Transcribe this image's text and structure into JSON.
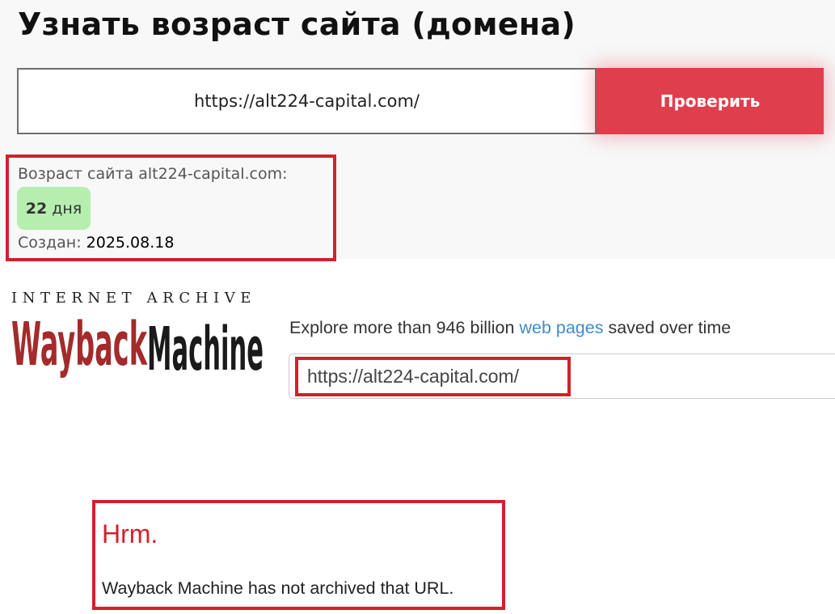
{
  "age_checker": {
    "title": "Узнать возраст сайта (домена)",
    "input_value": "https://alt224-capital.com/",
    "button_label": "Проверить",
    "result_label": "Возраст сайта alt224-capital.com:",
    "age_number": "22",
    "age_unit": "дня",
    "created_label": "Создан:",
    "created_value": "2025.08.18",
    "accent_color": "#df3e4c",
    "badge_color": "#b6eeb0",
    "highlight_color": "#d51f2c"
  },
  "wayback": {
    "header_text": "INTERNET ARCHIVE",
    "logo_text_1": "Wayback",
    "logo_text_2": "Machine",
    "tagline_prefix": "Explore more than 946 billion",
    "tagline_link": "web pages",
    "tagline_suffix": "saved over time",
    "search_value": "https://alt224-capital.com/",
    "error_title": "Hrm.",
    "error_message": "Wayback Machine has not archived that URL.",
    "logo_red": "#a32b2b",
    "logo_black": "#1a1a1a",
    "link_color": "#428bca"
  }
}
